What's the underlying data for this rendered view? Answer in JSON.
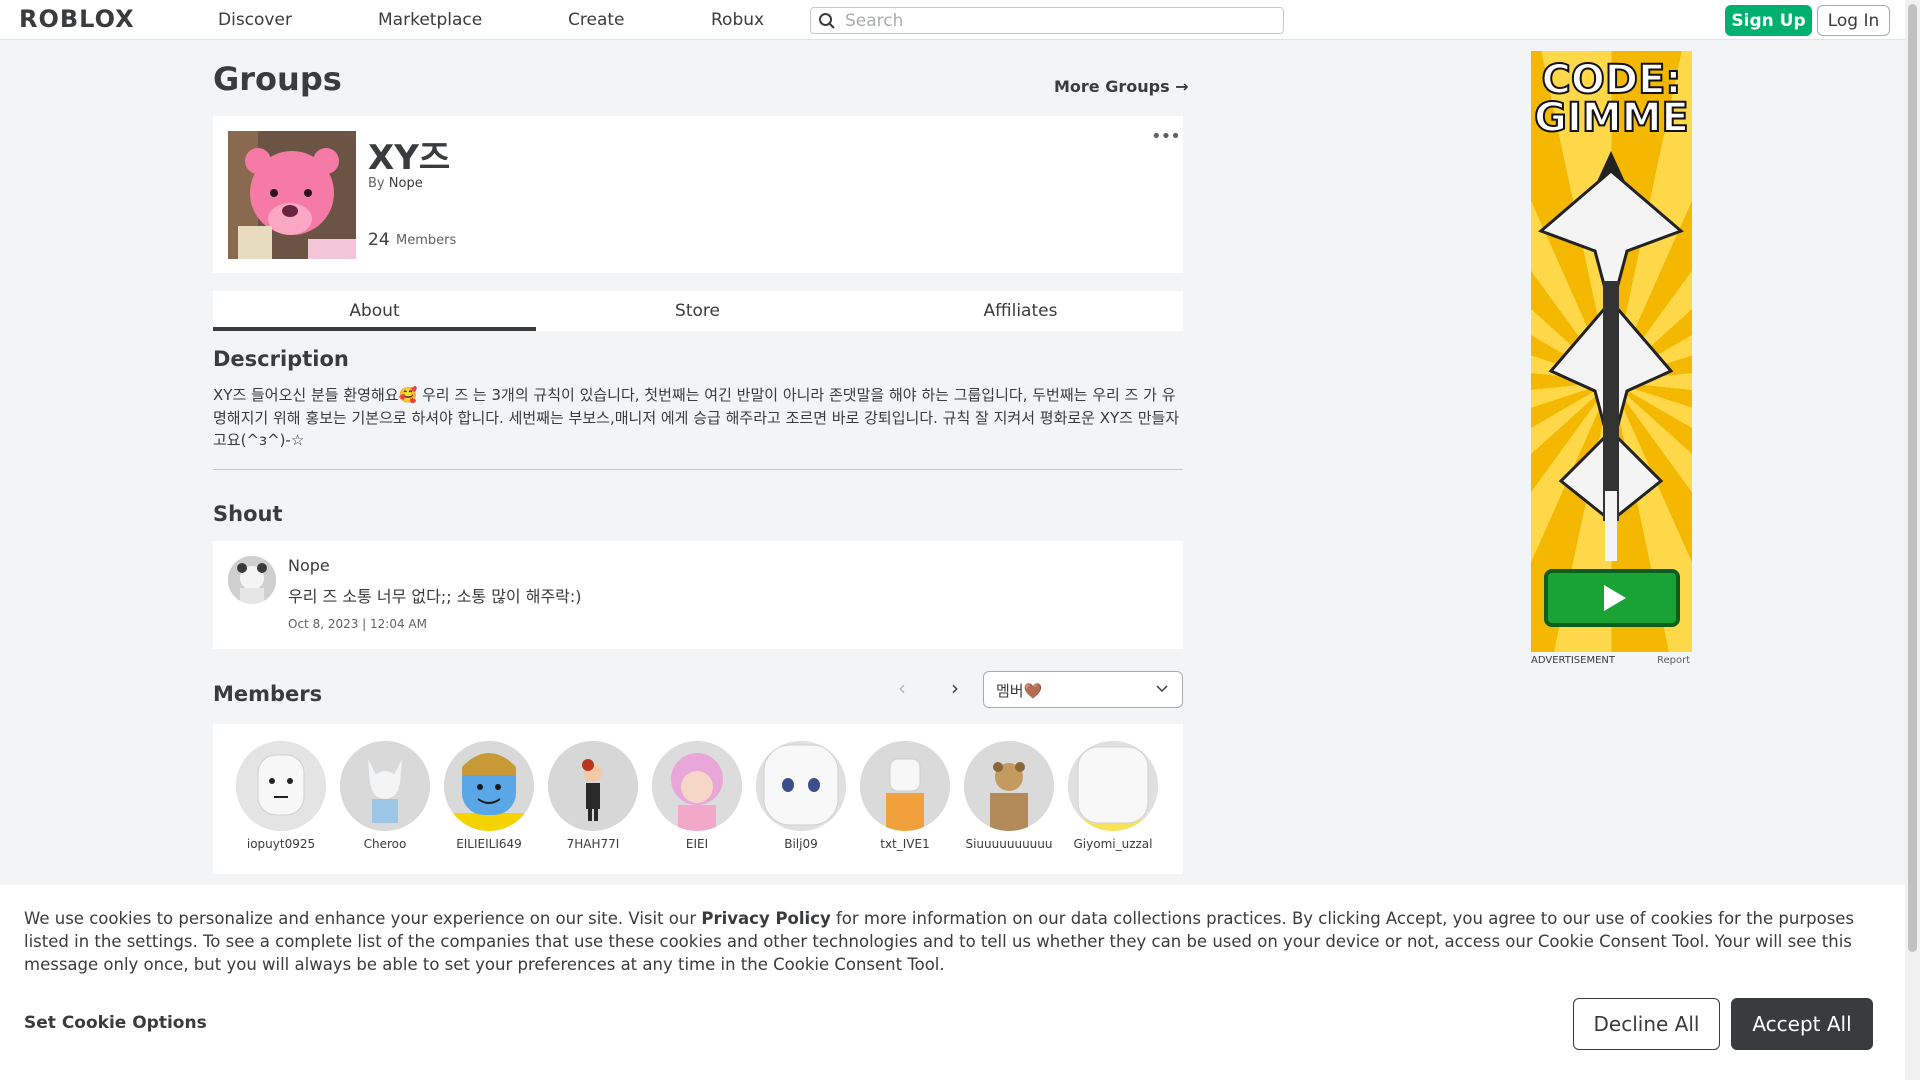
{
  "header": {
    "logo": "ROBLOX",
    "nav": [
      "Discover",
      "Marketplace",
      "Create",
      "Robux"
    ],
    "search_placeholder": "Search",
    "signup_label": "Sign Up",
    "login_label": "Log In"
  },
  "page": {
    "title": "Groups",
    "more_groups": "More Groups →"
  },
  "group": {
    "name": "XY즈",
    "by_label": "By",
    "owner": "Nope",
    "member_count": "24",
    "members_label": "Members",
    "more_menu": "•••"
  },
  "tabs": [
    {
      "label": "About",
      "active": true
    },
    {
      "label": "Store",
      "active": false
    },
    {
      "label": "Affiliates",
      "active": false
    }
  ],
  "about": {
    "description_heading": "Description",
    "description": "XY즈 들어오신 분들 환영해요🥰 우리 즈 는 3개의 규칙이 있습니다, 첫번째는 여긴 반말이 아니라 존댓말을 해야 하는 그룹입니다, 두번째는 우리 즈 가 유명해지기 위해 홍보는 기본으로 하셔야 합니다. 세번째는 부보스,매니저 에게 승급 해주라고 조르면 바로 강퇴입니다. 규칙 잘 지켜서 평화로운 XY즈 만들자고요(^з^)-☆"
  },
  "shout": {
    "heading": "Shout",
    "author": "Nope",
    "text": "우리 즈 소통 너무 없다;; 소통 많이 해주락:)",
    "date": "Oct 8, 2023 | 12:04 AM"
  },
  "members": {
    "heading": "Members",
    "prev": "‹",
    "next": "›",
    "role_selected": "멤버🤎",
    "list": [
      {
        "name": "iopuyt0925",
        "color": "#ededed"
      },
      {
        "name": "Cheroo",
        "color": "#cfe0ee"
      },
      {
        "name": "EILIEILI649",
        "color": "#5aa7e8"
      },
      {
        "name": "7HAH77I",
        "color": "#d7d7d7"
      },
      {
        "name": "EIEI",
        "color": "#f2b3d6"
      },
      {
        "name": "Bilj09",
        "color": "#f4f4f4"
      },
      {
        "name": "txt_IVE1",
        "color": "#f0a13c"
      },
      {
        "name": "Siuuuuuuuuuu",
        "color": "#c9a46b"
      },
      {
        "name": "Giyomi_uzzal",
        "color": "#f7f7f7"
      }
    ]
  },
  "ad": {
    "title": "CODE: GIMME",
    "label": "ADVERTISEMENT",
    "report": "Report"
  },
  "cookie": {
    "text_before": "We use cookies to personalize and enhance your experience on our site. Visit our ",
    "privacy_link": "Privacy Policy",
    "text_after": " for more information on our data collections practices. By clicking Accept, you agree to our use of cookies for the purposes listed in the settings. To see a complete list of the companies that use these cookies and other technologies and to tell us whether they can be used on your device or not, access our Cookie Consent Tool. Your will see this message only once, but you will always be able to set your preferences at any time in the Cookie Consent Tool.",
    "options_label": "Set Cookie Options",
    "decline_label": "Decline All",
    "accept_label": "Accept All"
  },
  "colors": {
    "signup": "#00b06f",
    "accept": "#393b3d",
    "background": "#f2f4f5"
  }
}
